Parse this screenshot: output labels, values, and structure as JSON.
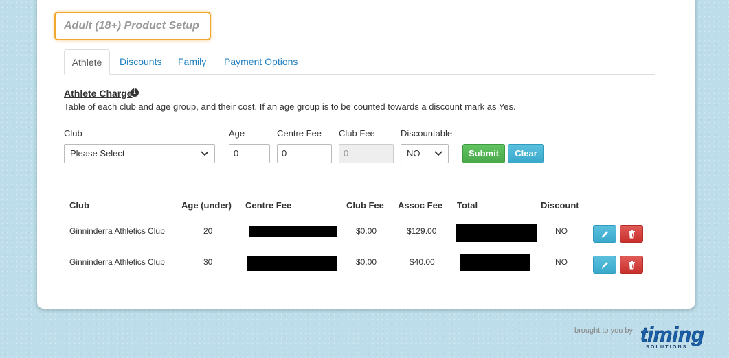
{
  "page": {
    "title": "Adult (18+) Product Setup"
  },
  "tabs": [
    {
      "label": "Athlete",
      "active": true
    },
    {
      "label": "Discounts",
      "active": false
    },
    {
      "label": "Family",
      "active": false
    },
    {
      "label": "Payment Options",
      "active": false
    }
  ],
  "section": {
    "title": "Athlete Charge ",
    "info_icon": "info-circle-icon",
    "description": "Table of each club and age group, and their cost. If an age group is to be counted towards a discount mark as Yes."
  },
  "form": {
    "club_label": "Club",
    "club_value": "Please Select",
    "age_label": "Age",
    "age_value": "0",
    "centre_fee_label": "Centre Fee",
    "centre_fee_value": "0",
    "club_fee_label": "Club Fee",
    "club_fee_value": "0",
    "discountable_label": "Discountable",
    "discountable_value": "NO",
    "submit_label": "Submit",
    "clear_label": "Clear"
  },
  "table": {
    "headers": [
      "Club",
      "Age (under)",
      "Centre Fee",
      "Club Fee",
      "Assoc Fee",
      "Total",
      "Discount"
    ],
    "rows": [
      {
        "club": "Ginninderra Athletics Club",
        "age": "20",
        "club_fee": "$0.00",
        "assoc_fee": "$129.00",
        "discount": "NO"
      },
      {
        "club": "Ginninderra Athletics Club",
        "age": "30",
        "club_fee": "$0.00",
        "assoc_fee": "$40.00",
        "discount": "NO"
      }
    ]
  },
  "footer": {
    "brought_by": "brought to you by",
    "logo_text": "timing",
    "logo_subtext": "SOLUTIONS"
  },
  "colors": {
    "link": "#1f7fc1",
    "title_highlight": "#f0a830",
    "submit": "#5cb85c",
    "clear": "#5bc0de",
    "delete": "#d9534f",
    "logo": "#1a5fa8"
  }
}
